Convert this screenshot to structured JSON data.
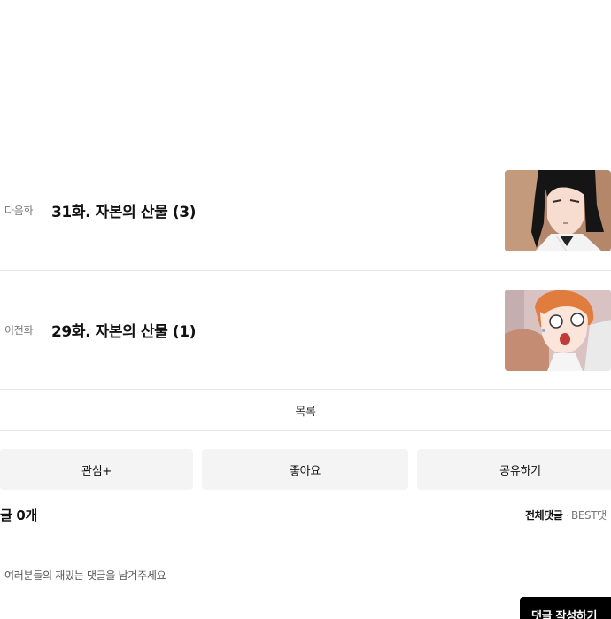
{
  "episodes": {
    "next": {
      "nav_label": "다음화",
      "title": "31화. 자본의 산물 (3)"
    },
    "prev": {
      "nav_label": "이전화",
      "title": "29화. 자본의 산물 (1)"
    }
  },
  "list_button": {
    "label": "목록"
  },
  "actions": {
    "favorite": "관심+",
    "like": "좋아요",
    "share": "공유하기"
  },
  "comments": {
    "count_label": "글 0개",
    "tab_all": "전체댓글",
    "tab_separator": "·",
    "tab_best": "BEST댓",
    "input_placeholder": "여러분들의 재밌는 댓글을 남겨주세요",
    "submit_label": "댓글 작성하기"
  },
  "colors": {
    "action_bg": "#f4f4f4",
    "divider": "#e8e8e8",
    "submit_bg": "#000000"
  }
}
